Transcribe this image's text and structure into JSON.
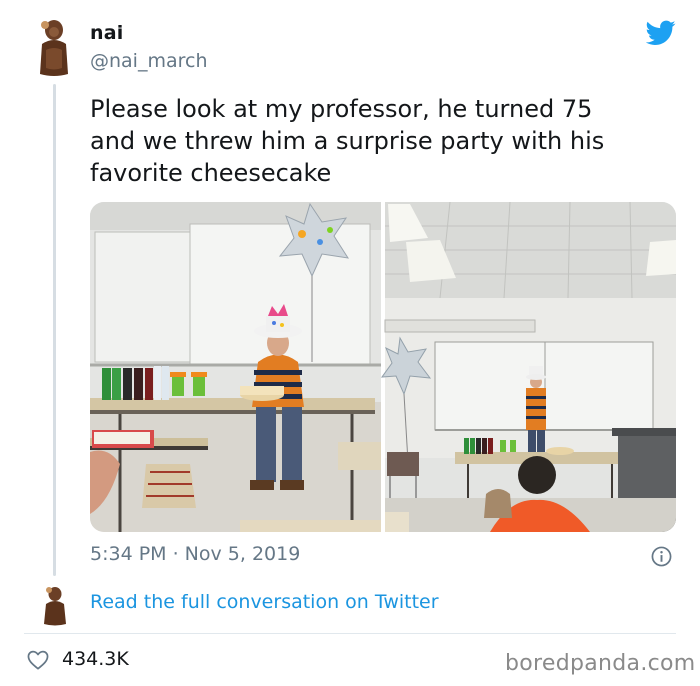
{
  "tweet": {
    "display_name": "nai",
    "handle": "@nai_march",
    "text": "Please look at my professor, he turned 75\nand we threw him a surprise party with his\nfavorite cheesecake",
    "timestamp": "5:34 PM · Nov 5, 2019",
    "read_link": "Read the full conversation on Twitter",
    "likes": "434.3K"
  },
  "watermark": "boredpanda.com",
  "icons": {
    "brand": "twitter-bird-icon",
    "info": "info-icon",
    "like": "heart-icon"
  },
  "colors": {
    "twitter_blue": "#1da1f2",
    "link_blue": "#1b95e0",
    "secondary_text": "#657786",
    "divider": "#e1e8ed"
  }
}
